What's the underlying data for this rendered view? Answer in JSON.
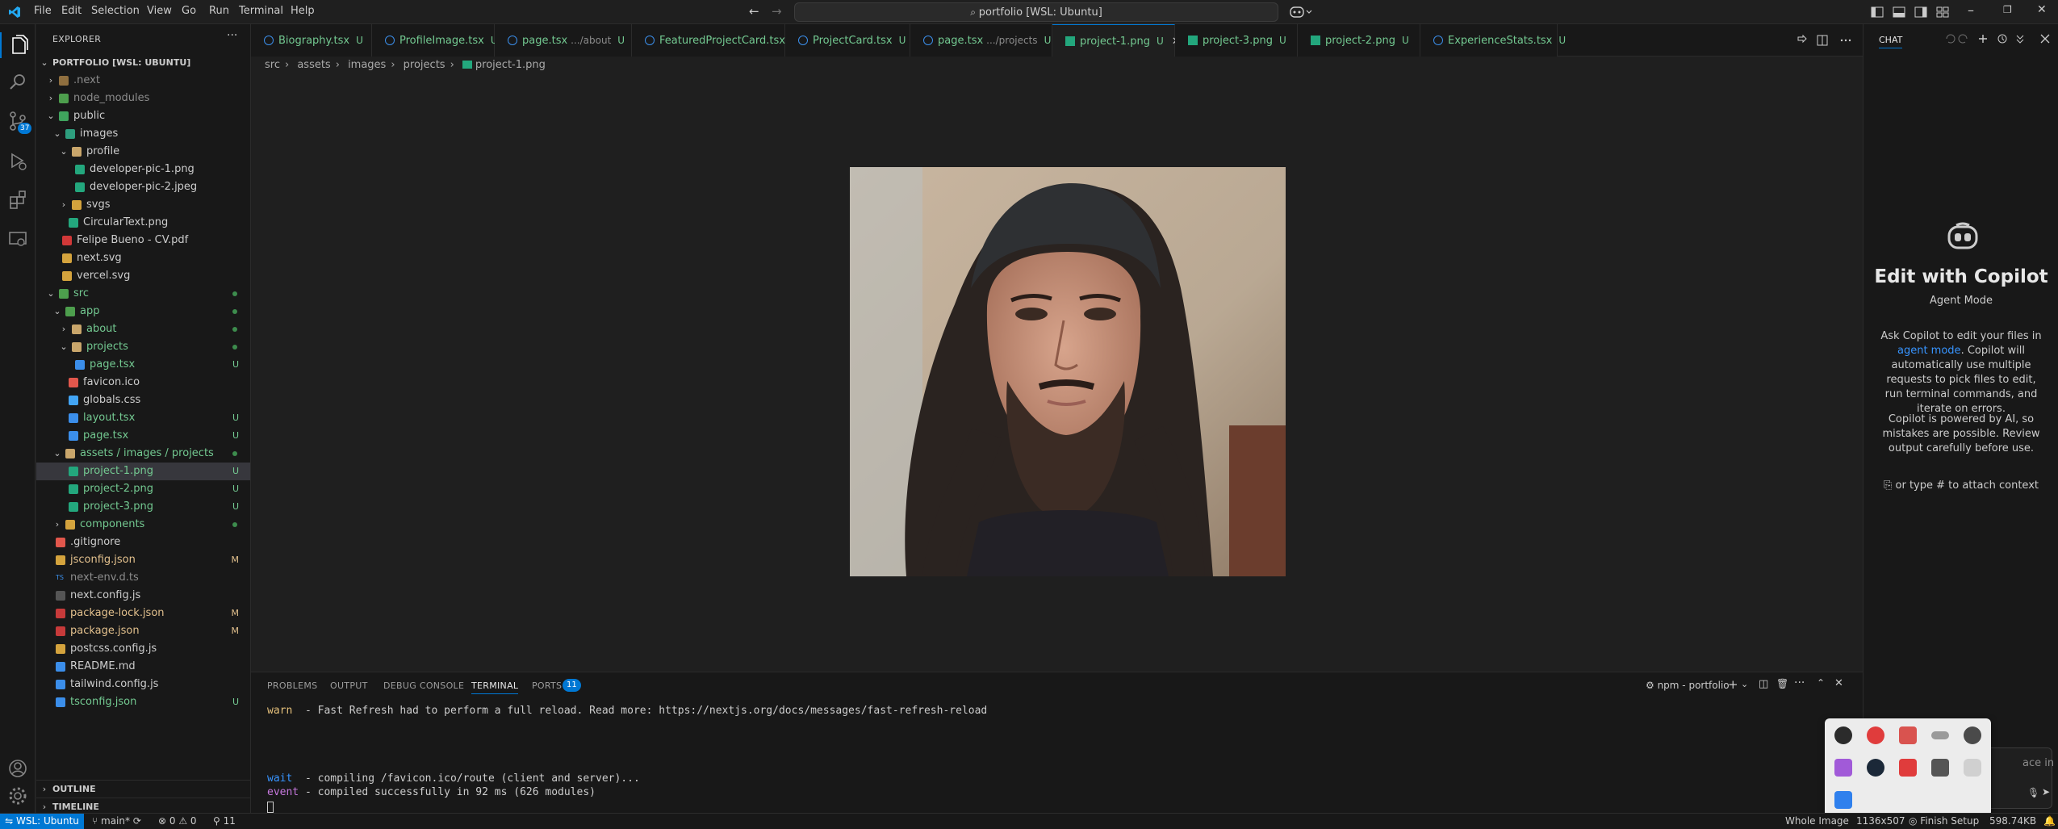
{
  "titlebar": {
    "menus": [
      "File",
      "Edit",
      "Selection",
      "View",
      "Go",
      "Run",
      "Terminal",
      "Help"
    ],
    "search": "portfolio [WSL: Ubuntu]"
  },
  "activity": {
    "scm_badge": "37"
  },
  "explorer": {
    "header": "EXPLORER",
    "root": "PORTFOLIO [WSL: UBUNTU]",
    "rows": [
      {
        "label": ".next",
        "depth": 1,
        "chev": "›",
        "color": "#8b8b8b",
        "icon": "#8f6f3f"
      },
      {
        "label": "node_modules",
        "depth": 1,
        "chev": "›",
        "color": "#8b8b8b",
        "icon": "#4d9e4d"
      },
      {
        "label": "public",
        "depth": 1,
        "chev": "⌄",
        "color": "#cccccc",
        "icon": "#3fa35d"
      },
      {
        "label": "images",
        "depth": 2,
        "chev": "⌄",
        "color": "#cccccc",
        "icon": "#2e9e7e"
      },
      {
        "label": "profile",
        "depth": 3,
        "chev": "⌄",
        "color": "#cccccc",
        "icon": "#c9a66b"
      },
      {
        "label": "developer-pic-1.png",
        "depth": 4,
        "color": "#cccccc",
        "icon": "#23a77d"
      },
      {
        "label": "developer-pic-2.jpeg",
        "depth": 4,
        "color": "#cccccc",
        "icon": "#23a77d"
      },
      {
        "label": "svgs",
        "depth": 3,
        "chev": "›",
        "color": "#cccccc",
        "icon": "#d4a33d"
      },
      {
        "label": "CircularText.png",
        "depth": 3,
        "color": "#cccccc",
        "icon": "#23a77d"
      },
      {
        "label": "Felipe Bueno - CV.pdf",
        "depth": 2,
        "color": "#cccccc",
        "icon": "#d13838"
      },
      {
        "label": "next.svg",
        "depth": 2,
        "color": "#cccccc",
        "icon": "#d4a33d"
      },
      {
        "label": "vercel.svg",
        "depth": 2,
        "color": "#cccccc",
        "icon": "#d4a33d"
      },
      {
        "label": "src",
        "depth": 1,
        "chev": "⌄",
        "color": "#73c991",
        "icon": "#4d9e4d",
        "dot": true
      },
      {
        "label": "app",
        "depth": 2,
        "chev": "⌄",
        "color": "#73c991",
        "icon": "#4d9e4d",
        "dot": true
      },
      {
        "label": "about",
        "depth": 3,
        "chev": "›",
        "color": "#73c991",
        "icon": "#c9a66b",
        "dot": true
      },
      {
        "label": "projects",
        "depth": 3,
        "chev": "⌄",
        "color": "#73c991",
        "icon": "#c9a66b",
        "dot": true
      },
      {
        "label": "page.tsx",
        "depth": 4,
        "color": "#73c991",
        "icon": "#3b8eea",
        "status": "U"
      },
      {
        "label": "favicon.ico",
        "depth": 3,
        "color": "#cccccc",
        "icon": "#e2574c"
      },
      {
        "label": "globals.css",
        "depth": 3,
        "color": "#cccccc",
        "icon": "#42a5f5"
      },
      {
        "label": "layout.tsx",
        "depth": 3,
        "color": "#73c991",
        "icon": "#3b8eea",
        "status": "U"
      },
      {
        "label": "page.tsx",
        "depth": 3,
        "color": "#73c991",
        "icon": "#3b8eea",
        "status": "U"
      },
      {
        "label": "assets / images / projects",
        "depth": 2,
        "chev": "⌄",
        "color": "#73c991",
        "icon": "#c9a66b",
        "dot": true
      },
      {
        "label": "project-1.png",
        "depth": 3,
        "color": "#73c991",
        "icon": "#23a77d",
        "status": "U",
        "selected": true
      },
      {
        "label": "project-2.png",
        "depth": 3,
        "color": "#73c991",
        "icon": "#23a77d",
        "status": "U"
      },
      {
        "label": "project-3.png",
        "depth": 3,
        "color": "#73c991",
        "icon": "#23a77d",
        "status": "U"
      },
      {
        "label": "components",
        "depth": 2,
        "chev": "›",
        "color": "#73c991",
        "icon": "#d4a33d",
        "dot": true
      },
      {
        "label": ".gitignore",
        "depth": 1,
        "color": "#cccccc",
        "icon": "#e2574c"
      },
      {
        "label": "jsconfig.json",
        "depth": 1,
        "color": "#e2c08d",
        "icon": "#d4a33d",
        "status": "M"
      },
      {
        "label": "next-env.d.ts",
        "depth": 1,
        "color": "#8b8b8b",
        "icon": "#3b8eea",
        "iconText": "TS"
      },
      {
        "label": "next.config.js",
        "depth": 1,
        "color": "#cccccc",
        "icon": "#555555"
      },
      {
        "label": "package-lock.json",
        "depth": 1,
        "color": "#e2c08d",
        "icon": "#c73a3a",
        "status": "M"
      },
      {
        "label": "package.json",
        "depth": 1,
        "color": "#e2c08d",
        "icon": "#c73a3a",
        "status": "M"
      },
      {
        "label": "postcss.config.js",
        "depth": 1,
        "color": "#cccccc",
        "icon": "#d4a33d"
      },
      {
        "label": "README.md",
        "depth": 1,
        "color": "#cccccc",
        "icon": "#3b8eea"
      },
      {
        "label": "tailwind.config.js",
        "depth": 1,
        "color": "#cccccc",
        "icon": "#3b8eea"
      },
      {
        "label": "tsconfig.json",
        "depth": 1,
        "color": "#73c991",
        "icon": "#3b8eea",
        "status": "U"
      }
    ],
    "outline": "OUTLINE",
    "timeline": "TIMELINE"
  },
  "tabs": [
    {
      "name": "Biography.tsx",
      "status": "U"
    },
    {
      "name": "ProfileImage.tsx",
      "status": "U"
    },
    {
      "name": "page.tsx",
      "path": ".../about",
      "status": "U"
    },
    {
      "name": "FeaturedProjectCard.tsx",
      "status": "U"
    },
    {
      "name": "ProjectCard.tsx",
      "status": "U"
    },
    {
      "name": "page.tsx",
      "path": ".../projects",
      "status": "U"
    },
    {
      "name": "project-1.png",
      "status": "U",
      "active": true
    },
    {
      "name": "project-3.png",
      "status": "U"
    },
    {
      "name": "project-2.png",
      "status": "U"
    },
    {
      "name": "ExperienceStats.tsx",
      "status": "U"
    }
  ],
  "breadcrumb": [
    "src",
    "assets",
    "images",
    "projects",
    "project-1.png"
  ],
  "panel": {
    "tabs": [
      "PROBLEMS",
      "OUTPUT",
      "DEBUG CONSOLE",
      "TERMINAL",
      "PORTS"
    ],
    "ports_badge": "11",
    "terminal_name": "npm - portfolio",
    "lines": [
      {
        "tag": "warn",
        "text": "  - Fast Refresh had to perform a full reload. Read more: https://nextjs.org/docs/messages/fast-refresh-reload"
      },
      {
        "tag": "wait",
        "text": "  - compiling /favicon.ico/route (client and server)..."
      },
      {
        "tag": "event",
        "text": " - compiled successfully in 92 ms (626 modules)"
      }
    ]
  },
  "chat": {
    "header": "CHAT",
    "title": "Edit with Copilot",
    "mode": "Agent Mode",
    "desc_before": "Ask Copilot to edit your files in",
    "desc_link": "agent mode",
    "desc_after": ". Copilot will automatically use multiple requests to pick files to edit, run terminal commands, and iterate on errors.",
    "disclaimer": "Copilot is powered by AI, so mistakes are possible. Review output carefully before use.",
    "attach": "or type # to attach context",
    "input_placeholder": "ace in agen"
  },
  "statusbar": {
    "remote": "WSL: Ubuntu",
    "branch": "main*",
    "errors": "0",
    "warnings": "0",
    "ports": "11",
    "right": [
      "Whole Image",
      "1136x507",
      "Finish Setup",
      "598.74KB"
    ]
  },
  "colors": {
    "accent": "#0078d4",
    "untracked": "#73c991",
    "modified": "#e2c08d"
  }
}
